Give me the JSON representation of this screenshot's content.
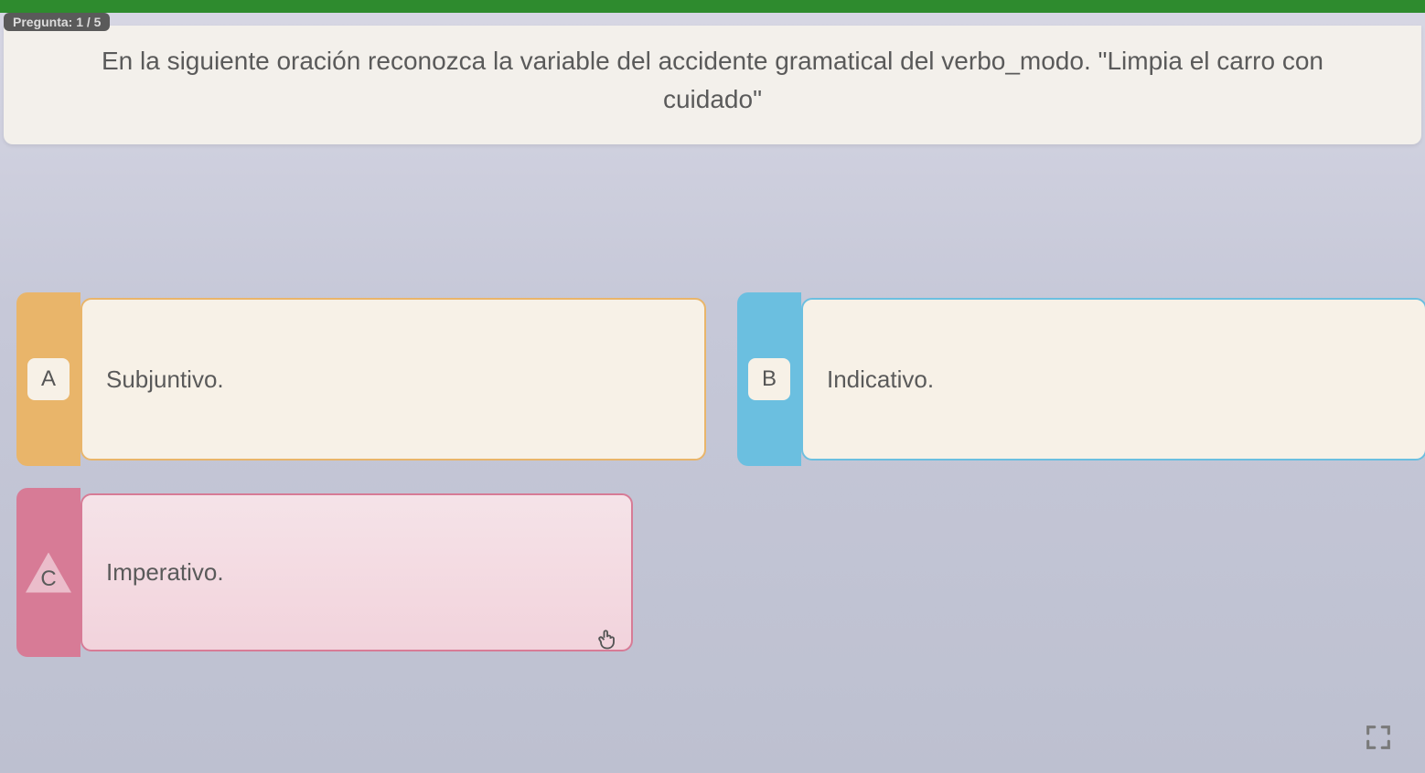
{
  "progress": {
    "label": "Pregunta: 1 / 5"
  },
  "question": {
    "text": "En la siguiente oración reconozca la variable del accidente gramatical del verbo_modo. \"Limpia el carro con cuidado\""
  },
  "options": {
    "a": {
      "letter": "A",
      "text": "Subjuntivo."
    },
    "b": {
      "letter": "B",
      "text": "Indicativo."
    },
    "c": {
      "letter": "C",
      "text": "Imperativo."
    }
  },
  "colors": {
    "a": "#e9b56a",
    "b": "#6bbfe0",
    "c": "#d77b96"
  }
}
